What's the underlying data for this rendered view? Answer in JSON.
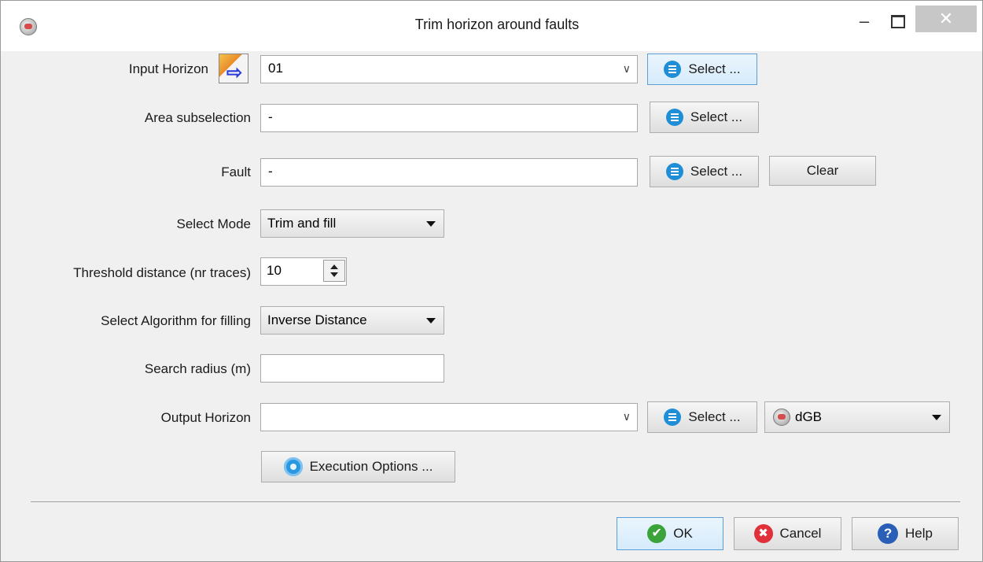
{
  "window": {
    "title": "Trim horizon around faults",
    "minimize": "–",
    "close": "✕"
  },
  "input_horizon": {
    "label": "Input Horizon",
    "value": "01",
    "select_label": "Select ..."
  },
  "area_subselection": {
    "label": "Area subselection",
    "value": "-",
    "select_label": "Select ..."
  },
  "fault": {
    "label": "Fault",
    "value": "-",
    "select_label": "Select ...",
    "clear_label": "Clear"
  },
  "select_mode": {
    "label": "Select Mode",
    "value": "Trim and fill"
  },
  "threshold": {
    "label": "Threshold distance (nr traces)",
    "value": "10"
  },
  "algorithm": {
    "label": "Select Algorithm for filling",
    "value": "Inverse Distance"
  },
  "search_radius": {
    "label": "Search radius (m)",
    "value": ""
  },
  "output_horizon": {
    "label": "Output Horizon",
    "value": "",
    "select_label": "Select ...",
    "format": "dGB"
  },
  "execution_options": {
    "label": "Execution Options ..."
  },
  "footer": {
    "ok": "OK",
    "cancel": "Cancel",
    "help": "Help"
  },
  "icons": {
    "app": "opendtect-app-icon",
    "input_horizon": "horizon-input-icon",
    "select": "list-icon",
    "format": "dgb-icon",
    "execution": "gear-icon",
    "ok": "check-icon",
    "cancel": "cancel-icon",
    "help": "help-icon"
  }
}
